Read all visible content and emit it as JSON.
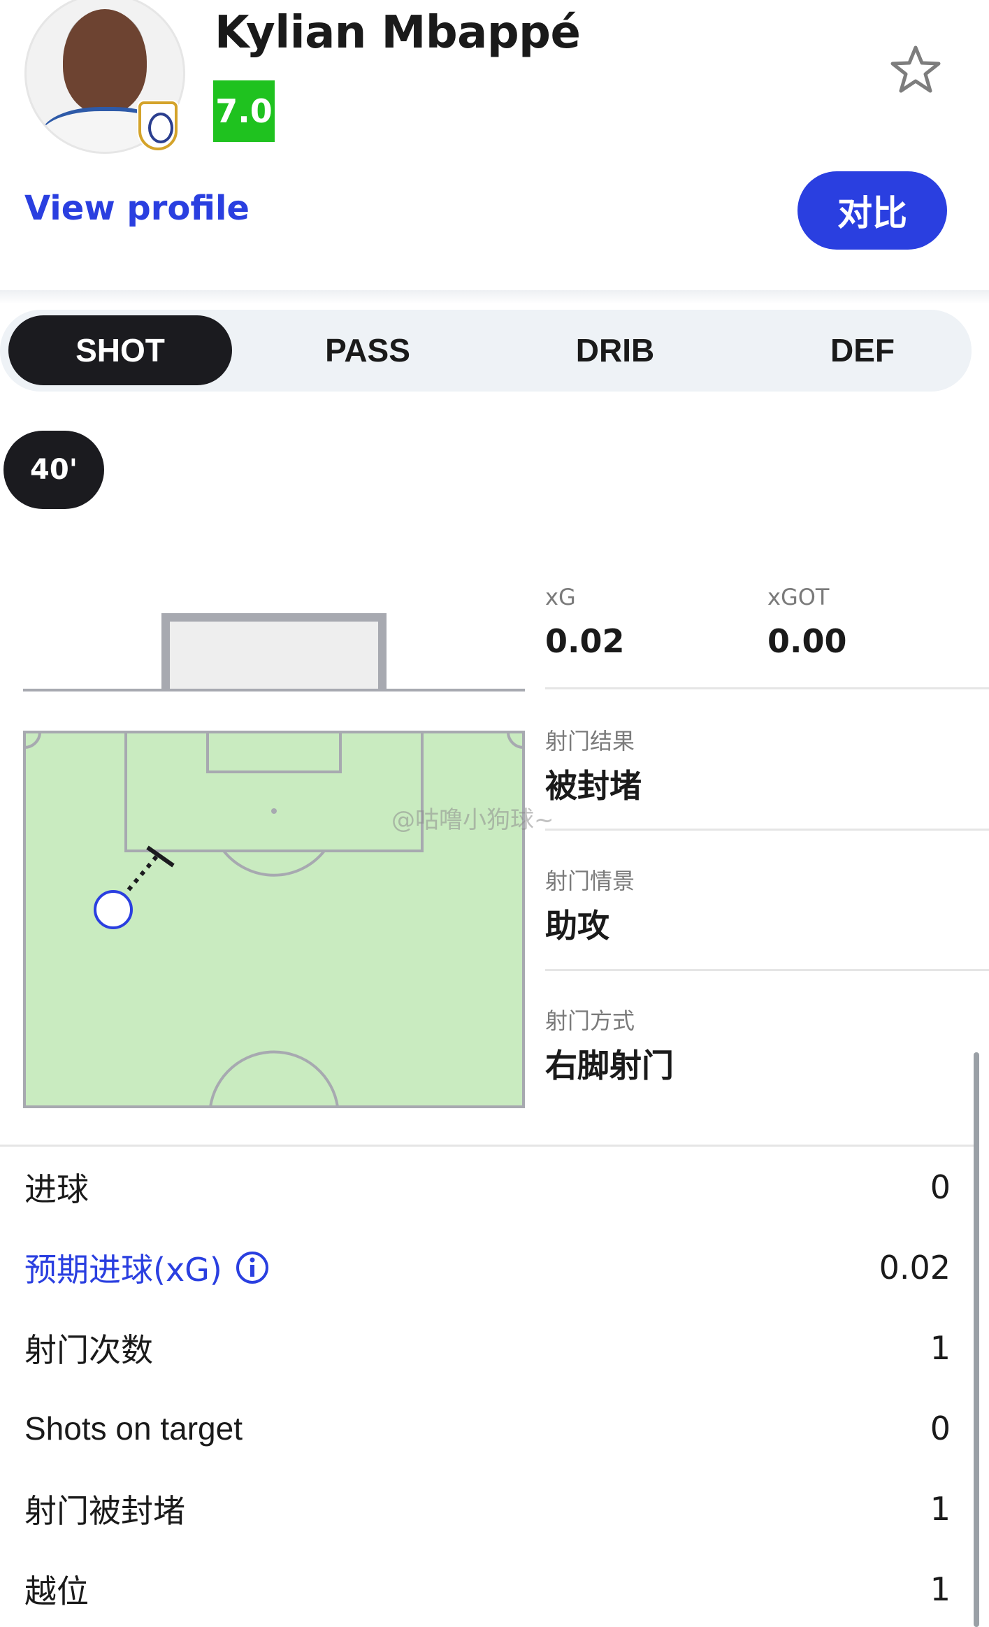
{
  "player": {
    "name": "Kylian Mbappé",
    "rating": "7.0",
    "rating_color": "#1fc21f",
    "view_profile": "View profile",
    "compare_label": "对比",
    "favorite_icon": "star-outline-icon"
  },
  "tabs": [
    {
      "label": "SHOT",
      "active": true
    },
    {
      "label": "PASS",
      "active": false
    },
    {
      "label": "DRIB",
      "active": false
    },
    {
      "label": "DEF",
      "active": false
    }
  ],
  "shot": {
    "minute": "40'",
    "xg_label": "xG",
    "xg_value": "0.02",
    "xgot_label": "xGOT",
    "xgot_value": "0.00",
    "result_label": "射门结果",
    "result_value": "被封堵",
    "situation_label": "射门情景",
    "situation_value": "助攻",
    "type_label": "射门方式",
    "type_value": "右脚射门"
  },
  "watermark": "@咕噜小狗球~",
  "stats": [
    {
      "label": "进球",
      "value": "0",
      "link": false
    },
    {
      "label": "预期进球(xG)",
      "value": "0.02",
      "link": true
    },
    {
      "label": "射门次数",
      "value": "1",
      "link": false
    },
    {
      "label": "Shots on target",
      "value": "0",
      "link": false
    },
    {
      "label": "射门被封堵",
      "value": "1",
      "link": false
    },
    {
      "label": "越位",
      "value": "1",
      "link": false
    }
  ],
  "colors": {
    "accent": "#2a3fe0",
    "pitch": "#c9ebc0",
    "pitch_lines": "#a7a9b0",
    "shot_marker": "#2a3fe0",
    "tab_active": "#1b1b1f"
  }
}
